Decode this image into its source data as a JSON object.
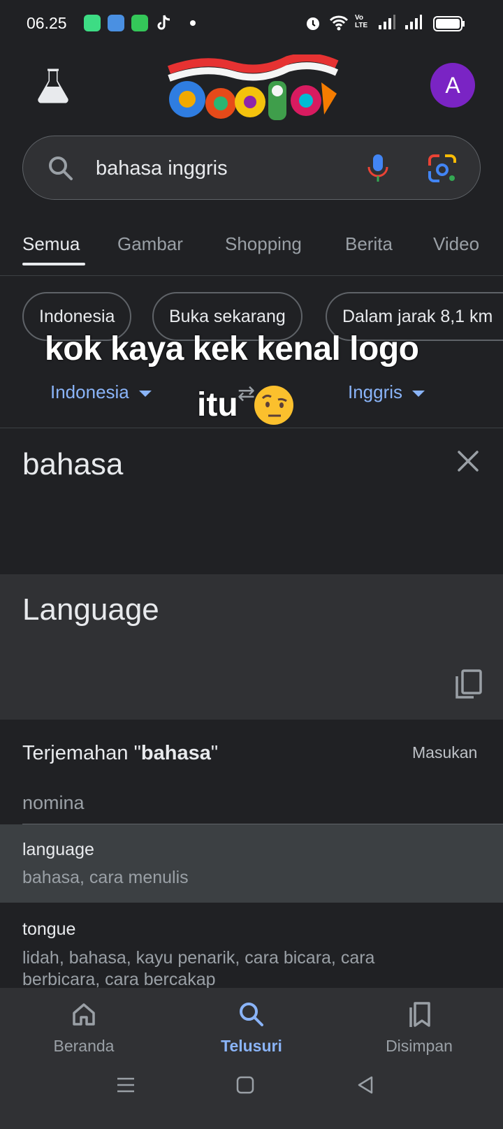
{
  "status_bar": {
    "time": "06.25"
  },
  "header": {
    "avatar_initial": "A"
  },
  "search": {
    "query": "bahasa inggris"
  },
  "tabs": [
    {
      "label": "Semua"
    },
    {
      "label": "Gambar"
    },
    {
      "label": "Shopping"
    },
    {
      "label": "Berita"
    },
    {
      "label": "Video"
    }
  ],
  "chips": [
    {
      "label": "Indonesia"
    },
    {
      "label": "Buka sekarang"
    },
    {
      "label": "Dalam jarak 8,1 km"
    }
  ],
  "overlay": {
    "line1": "kok kaya kek kenal logo",
    "line2": "itu"
  },
  "translator": {
    "source_lang": "Indonesia",
    "target_lang": "Inggris",
    "source_text": "bahasa",
    "output_text": "Language"
  },
  "dictionary": {
    "title_prefix": "Terjemahan \"",
    "title_word": "bahasa",
    "title_suffix": "\"",
    "feedback": "Masukan",
    "part_of_speech": "nomina",
    "entries": [
      {
        "word": "language",
        "meanings": "bahasa, cara menulis"
      },
      {
        "word": "tongue",
        "meanings": "lidah, bahasa, kayu penarik, cara bicara, cara berbicara, cara bercakap"
      }
    ]
  },
  "bottom_nav": [
    {
      "label": "Beranda",
      "icon": "home-icon"
    },
    {
      "label": "Telusuri",
      "icon": "search-icon"
    },
    {
      "label": "Disimpan",
      "icon": "bookmarks-icon"
    }
  ],
  "colors": {
    "background": "#202124",
    "accent": "#8ab4f8",
    "avatar": "#7a24c4"
  }
}
